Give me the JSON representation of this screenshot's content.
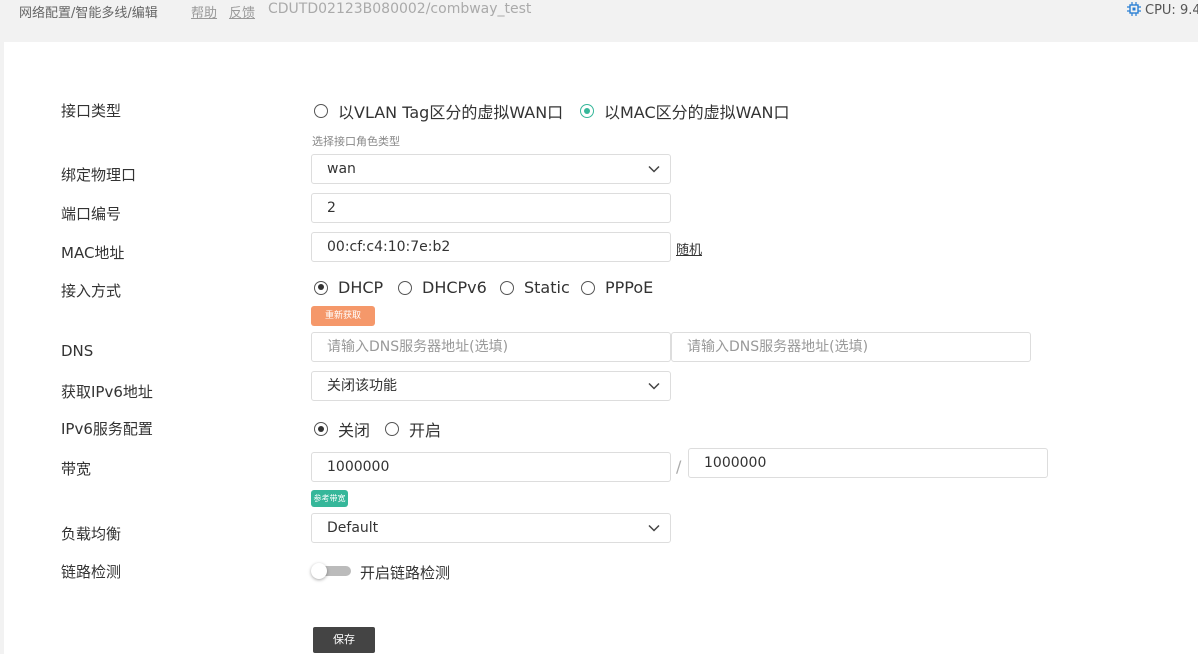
{
  "header": {
    "breadcrumb": "网络配置/智能多线/编辑",
    "help": "帮助",
    "feedback": "反馈",
    "device": "CDUTD02123B080002/combway_test",
    "cpu": "CPU: 9.4"
  },
  "form": {
    "interface_type": {
      "label": "接口类型",
      "options": [
        "以VLAN Tag区分的虚拟WAN口",
        "以MAC区分的虚拟WAN口"
      ],
      "selected": "以MAC区分的虚拟WAN口",
      "hint": "选择接口角色类型"
    },
    "bind_port": {
      "label": "绑定物理口",
      "value": "wan"
    },
    "port_number": {
      "label": "端口编号",
      "value": "2"
    },
    "mac": {
      "label": "MAC地址",
      "value": "00:cf:c4:10:7e:b2",
      "random_link": "随机"
    },
    "access_mode": {
      "label": "接入方式",
      "options": [
        "DHCP",
        "DHCPv6",
        "Static",
        "PPPoE"
      ],
      "selected": "DHCP",
      "reacquire_button": "重新获取"
    },
    "dns": {
      "label": "DNS",
      "placeholder1": "请输入DNS服务器地址(选填)",
      "placeholder2": "请输入DNS服务器地址(选填)"
    },
    "ipv6_addr": {
      "label": "获取IPv6地址",
      "value": "关闭该功能"
    },
    "ipv6_service": {
      "label": "IPv6服务配置",
      "options": [
        "关闭",
        "开启"
      ],
      "selected": "关闭"
    },
    "bandwidth": {
      "label": "带宽",
      "up": "1000000",
      "separator": "/",
      "down": "1000000",
      "ref_button": "参考带宽"
    },
    "load_balance": {
      "label": "负载均衡",
      "value": "Default"
    },
    "link_detect": {
      "label": "链路检测",
      "toggle_label": "开启链路检测",
      "enabled": false
    },
    "save_button": "保存"
  },
  "colors": {
    "accent_green": "#36b79a",
    "orange": "#f5986a",
    "save_bg": "#444444"
  }
}
